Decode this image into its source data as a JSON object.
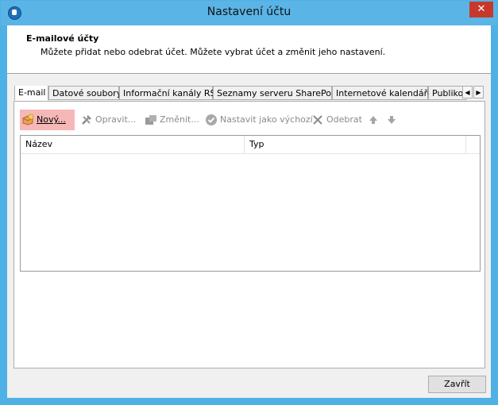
{
  "window": {
    "title": "Nastavení účtu",
    "close_glyph": "✕"
  },
  "header": {
    "title": "E-mailové účty",
    "description": "Můžete přidat nebo odebrat účet. Můžete vybrat účet a změnit jeho nastavení."
  },
  "tabs": [
    {
      "label": "E-mail",
      "active": true
    },
    {
      "label": "Datové soubory"
    },
    {
      "label": "Informační kanály RSS"
    },
    {
      "label": "Seznamy serveru SharePoint"
    },
    {
      "label": "Internetové kalendáře"
    },
    {
      "label": "Publikov"
    }
  ],
  "toolbar": {
    "new": "Nový...",
    "repair": "Opravit...",
    "change": "Změnit...",
    "set_default": "Nastavit jako výchozí",
    "remove": "Odebrat"
  },
  "list": {
    "columns": [
      "Název",
      "Typ"
    ]
  },
  "footer": {
    "close_label": "Zavřít"
  },
  "colors": {
    "accent": "#5ab4e6",
    "highlight": "#f6b7b7",
    "close": "#c7382c"
  }
}
